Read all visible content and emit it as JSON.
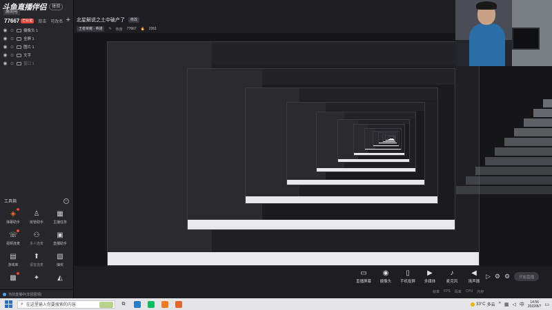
{
  "app": {
    "logo_text": "斗鱼直播伴侣",
    "version_badge": "体验",
    "room_label": "房间号"
  },
  "room": {
    "id": "77667",
    "tag": "已认证",
    "link_a": "双击",
    "link_b": "可改名"
  },
  "sources": [
    {
      "label": "摄像头 1",
      "dim": false
    },
    {
      "label": "全屏 1",
      "dim": false
    },
    {
      "label": "图片 1",
      "dim": false
    },
    {
      "label": "文字",
      "dim": false
    },
    {
      "label": "窗口 1",
      "dim": true
    }
  ],
  "tools": {
    "title": "工具箱",
    "collapse_glyph": "−",
    "items": [
      {
        "label": "弹幕助手",
        "glyph": "◈",
        "accent": true,
        "dot": true,
        "muted": false
      },
      {
        "label": "房管助手",
        "glyph": "♙",
        "accent": false,
        "dot": false,
        "muted": false
      },
      {
        "label": "主播任务",
        "glyph": "▦",
        "accent": false,
        "dot": false,
        "muted": false
      },
      {
        "label": "视频连麦",
        "glyph": "☏",
        "accent": false,
        "dot": true,
        "muted": false
      },
      {
        "label": "多人连麦",
        "glyph": "⚇",
        "accent": false,
        "dot": false,
        "muted": true
      },
      {
        "label": "直播助手",
        "glyph": "▣",
        "accent": false,
        "dot": false,
        "muted": false
      },
      {
        "label": "游戏库",
        "glyph": "▤",
        "accent": false,
        "dot": false,
        "muted": false
      },
      {
        "label": "语音连麦",
        "glyph": "⬆",
        "accent": false,
        "dot": false,
        "muted": true
      },
      {
        "label": "抽奖",
        "glyph": "▧",
        "accent": false,
        "dot": false,
        "muted": false
      },
      {
        "label": "",
        "glyph": "▩",
        "accent": false,
        "dot": true,
        "muted": false
      },
      {
        "label": "",
        "glyph": "✦",
        "accent": false,
        "dot": false,
        "muted": false
      },
      {
        "label": "",
        "glyph": "◭",
        "accent": false,
        "dot": false,
        "muted": false
      }
    ]
  },
  "status": {
    "text": "当前直播中(非团团领)"
  },
  "stream": {
    "title": "北星解说之土中破产了",
    "edit_label": "修改",
    "category": "王者荣耀 · 英雄",
    "edit_cat_icon": "✎",
    "hot_label": "热度",
    "hot_value": "77667",
    "fire_icon": "🔥",
    "fans_value": "2261"
  },
  "controls": {
    "items": [
      {
        "label": "直播屏幕",
        "glyph": "▭",
        "name": "screen-share-button"
      },
      {
        "label": "摄像头",
        "glyph": "◉",
        "name": "camera-button"
      },
      {
        "label": "手机投屏",
        "glyph": "▯",
        "name": "phone-cast-button"
      },
      {
        "label": "多媒体",
        "glyph": "▶",
        "name": "media-button"
      },
      {
        "label": "麦克风",
        "glyph": "♪",
        "name": "microphone-button"
      },
      {
        "label": "扬声器",
        "glyph": "◀",
        "name": "speaker-button"
      }
    ],
    "start_label": "开始直播",
    "right_icons": [
      "▷",
      "⚙",
      "⚙"
    ],
    "stats": [
      "帧率",
      "FPS",
      "码率",
      "CPU",
      "内存"
    ]
  },
  "taskbar": {
    "search_placeholder": "在这里输入你要搜索的内容",
    "apps": [
      {
        "color": "#2a7ec7",
        "name": "edge-icon"
      },
      {
        "color": "#07c160",
        "name": "wechat-icon"
      },
      {
        "color": "#f07b20",
        "name": "app-icon-orange"
      },
      {
        "color": "#e8652a",
        "name": "app-icon-orange-2"
      }
    ],
    "temperature": "33°C",
    "weather": "多云",
    "time": "14:56",
    "date": "2022/8/7"
  },
  "colors": {
    "accent": "#f06a2d",
    "badge_red": "#e8453c",
    "panel": "#26262b",
    "preview": "#161618"
  }
}
